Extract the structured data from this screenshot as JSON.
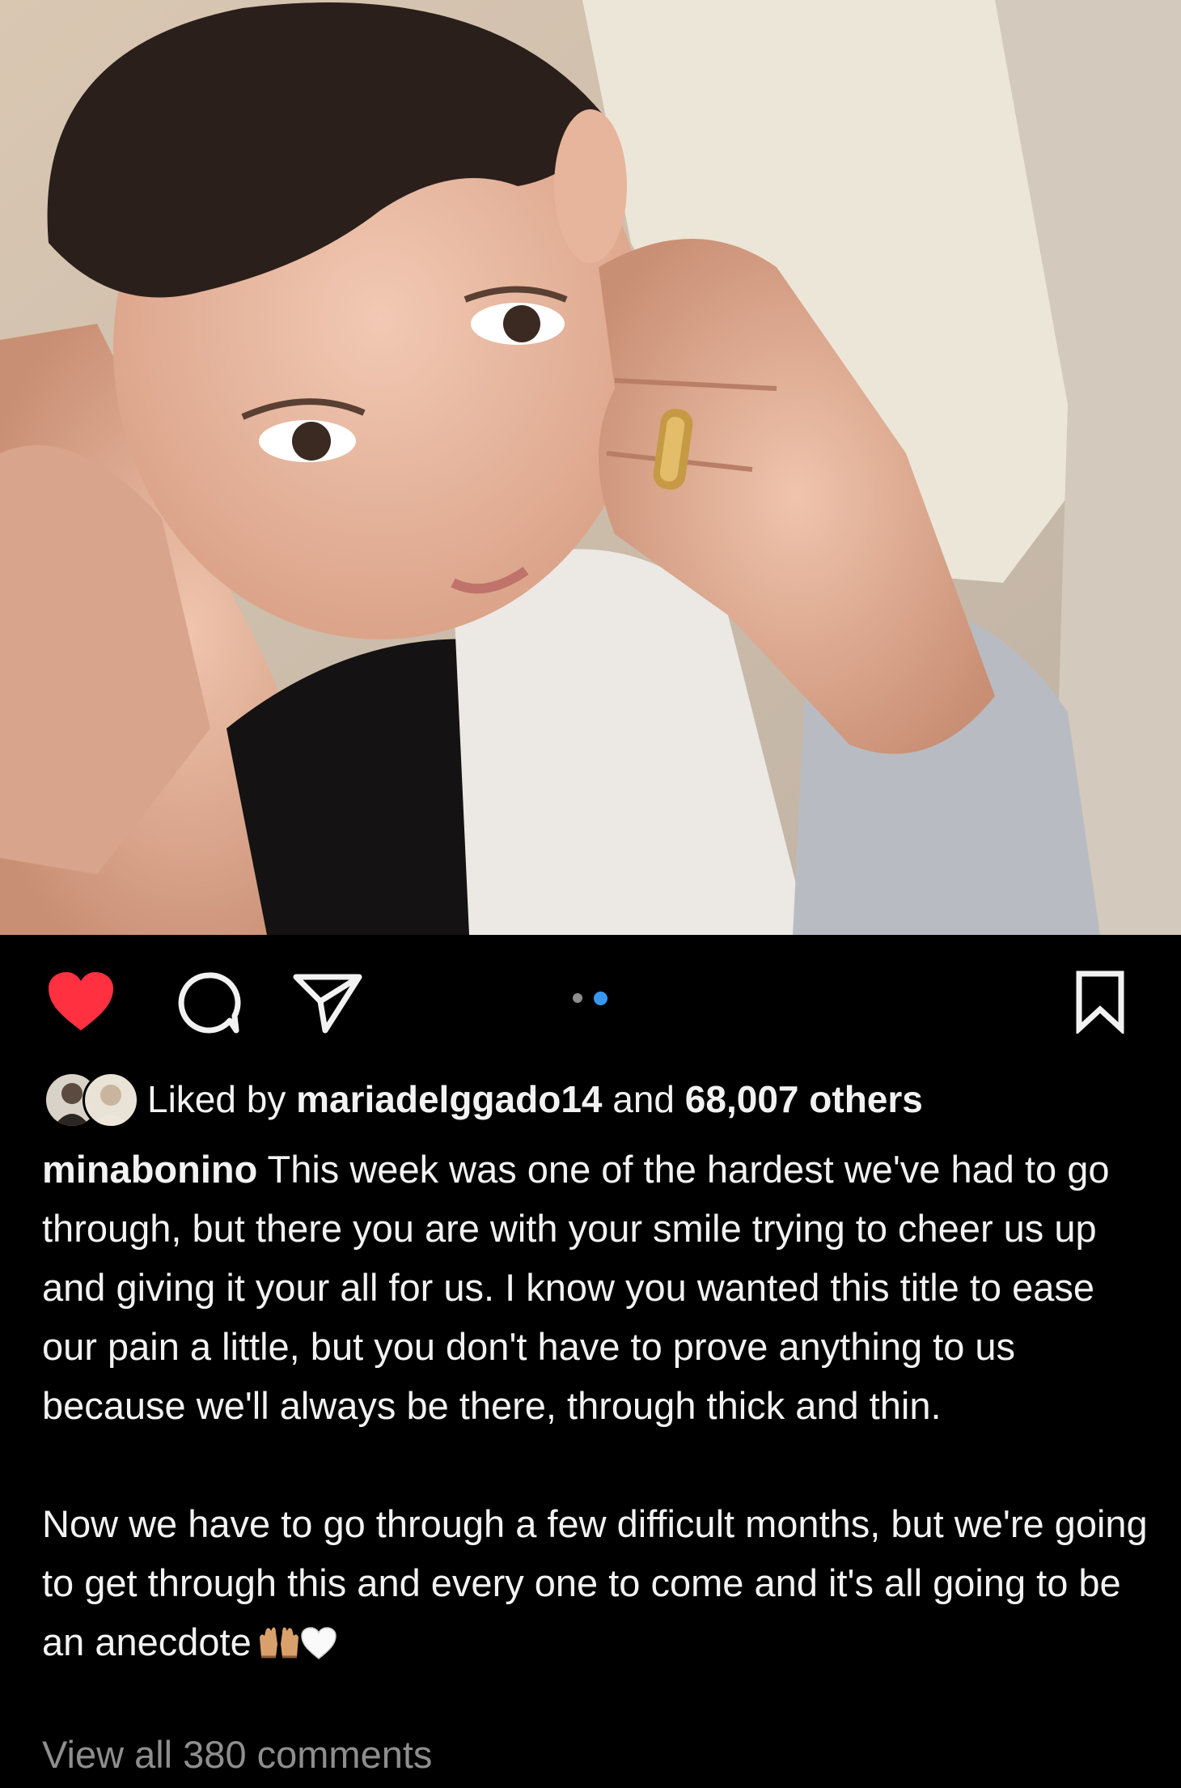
{
  "post": {
    "image_description_icon": "photo-child-hugged",
    "carousel": {
      "current_index": 2,
      "total": 2
    },
    "liked": true,
    "saved": false,
    "likes": {
      "prefix": "Liked by ",
      "user": "mariadelggado14",
      "connector": " and ",
      "others": "68,007 others"
    },
    "caption": {
      "username": "minabonino",
      "paragraph1": " This week was one of the hardest we've had to go through, but there you are with your smile trying to cheer us up and giving it your all for us. I know you wanted this title to ease our pain a little, but you don't have to prove anything to us because we'll always be there, through thick and thin.",
      "paragraph2": "Now we have to go through a few difficult months, but we're going to get through this and every one to come and it's all going to be an anecdote"
    },
    "view_comments": "View all 380 comments"
  },
  "colors": {
    "heart": "#ff3040",
    "active_dot": "#3897f0",
    "inactive_dot": "#8e8e8e"
  }
}
